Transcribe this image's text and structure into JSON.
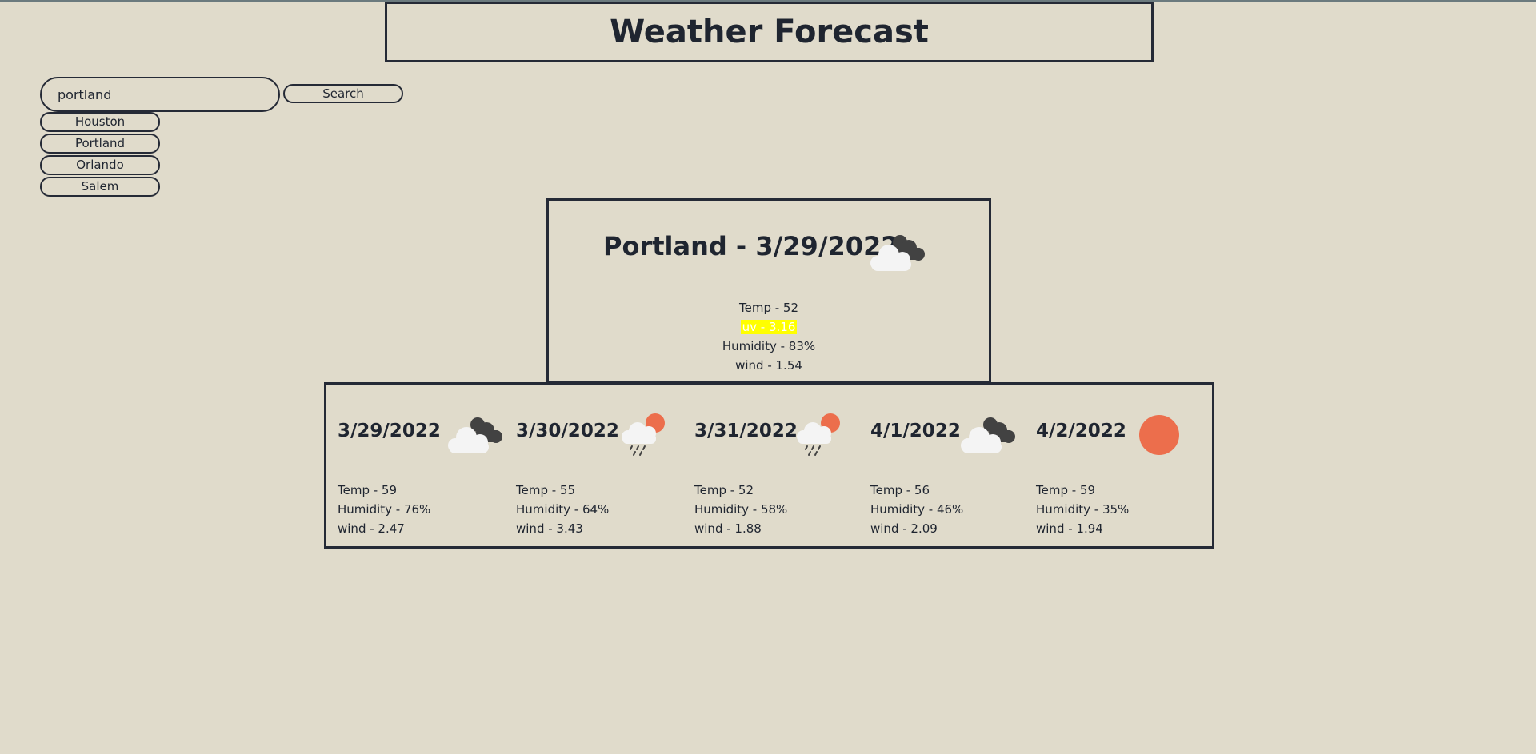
{
  "header": {
    "title": "Weather Forecast"
  },
  "search": {
    "value": "portland",
    "button_label": "Search"
  },
  "history": [
    {
      "label": "Houston"
    },
    {
      "label": "Portland"
    },
    {
      "label": "Orlando"
    },
    {
      "label": "Salem"
    }
  ],
  "current": {
    "title": "Portland - 3/29/2022",
    "icon": "partly-cloudy-icon",
    "temp": "Temp - 52",
    "uv": "uv - 3.16",
    "humidity": "Humidity - 83%",
    "wind": "wind - 1.54"
  },
  "forecast": [
    {
      "date": "3/29/2022",
      "icon": "cloudy-icon",
      "temp": "Temp - 59",
      "humidity": "Humidity - 76%",
      "wind": "wind - 2.47"
    },
    {
      "date": "3/30/2022",
      "icon": "rain-sun-icon",
      "temp": "Temp - 55",
      "humidity": "Humidity - 64%",
      "wind": "wind - 3.43"
    },
    {
      "date": "3/31/2022",
      "icon": "rain-sun-icon",
      "temp": "Temp - 52",
      "humidity": "Humidity - 58%",
      "wind": "wind - 1.88"
    },
    {
      "date": "4/1/2022",
      "icon": "cloudy-icon",
      "temp": "Temp - 56",
      "humidity": "Humidity - 46%",
      "wind": "wind - 2.09"
    },
    {
      "date": "4/2/2022",
      "icon": "sun-icon",
      "temp": "Temp - 59",
      "humidity": "Humidity - 35%",
      "wind": "wind - 1.94"
    }
  ],
  "colors": {
    "background": "#e0dbcb",
    "border": "#252a36",
    "uv_highlight": "#ffff00",
    "sun": "#ec6e4c",
    "cloud_light": "#f4f4f4",
    "cloud_dark": "#424242"
  }
}
